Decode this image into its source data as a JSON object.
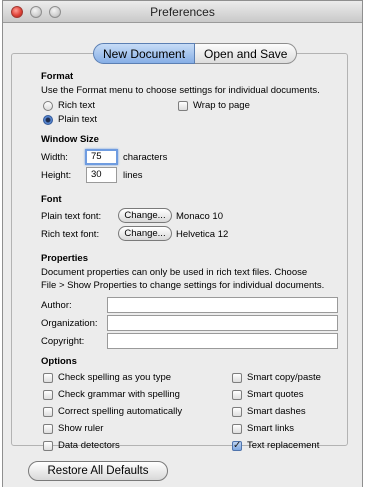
{
  "window": {
    "title": "Preferences"
  },
  "tabs": [
    {
      "label": "New Document",
      "selected": true
    },
    {
      "label": "Open and Save",
      "selected": false
    }
  ],
  "format": {
    "heading": "Format",
    "description": "Use the Format menu to choose settings for individual documents.",
    "rich_text_label": "Rich text",
    "plain_text_label": "Plain text",
    "wrap_label": "Wrap to page",
    "selected": "Plain text",
    "wrap_checked": false
  },
  "window_size": {
    "heading": "Window Size",
    "width_label": "Width:",
    "width_value": "75",
    "width_unit": "characters",
    "height_label": "Height:",
    "height_value": "30",
    "height_unit": "lines"
  },
  "font": {
    "heading": "Font",
    "plain_label": "Plain text font:",
    "plain_button": "Change...",
    "plain_value": "Monaco 10",
    "rich_label": "Rich text font:",
    "rich_button": "Change...",
    "rich_value": "Helvetica 12"
  },
  "properties": {
    "heading": "Properties",
    "description_line1": "Document properties can only be used in rich text files. Choose",
    "description_line2": "File > Show Properties to change settings for individual documents.",
    "author_label": "Author:",
    "author_value": "",
    "organization_label": "Organization:",
    "organization_value": "",
    "copyright_label": "Copyright:",
    "copyright_value": ""
  },
  "options": {
    "heading": "Options",
    "left": [
      {
        "label": "Check spelling as you type",
        "checked": false
      },
      {
        "label": "Check grammar with spelling",
        "checked": false
      },
      {
        "label": "Correct spelling automatically",
        "checked": false
      },
      {
        "label": "Show ruler",
        "checked": false
      },
      {
        "label": "Data detectors",
        "checked": false
      }
    ],
    "right": [
      {
        "label": "Smart copy/paste",
        "checked": false
      },
      {
        "label": "Smart quotes",
        "checked": false
      },
      {
        "label": "Smart dashes",
        "checked": false
      },
      {
        "label": "Smart links",
        "checked": false
      },
      {
        "label": "Text replacement",
        "checked": true
      }
    ]
  },
  "restore_button": "Restore All Defaults",
  "colors": {
    "accent": "#3a6bc0",
    "window_bg": "#ececec",
    "close_button": "#e0443a"
  }
}
